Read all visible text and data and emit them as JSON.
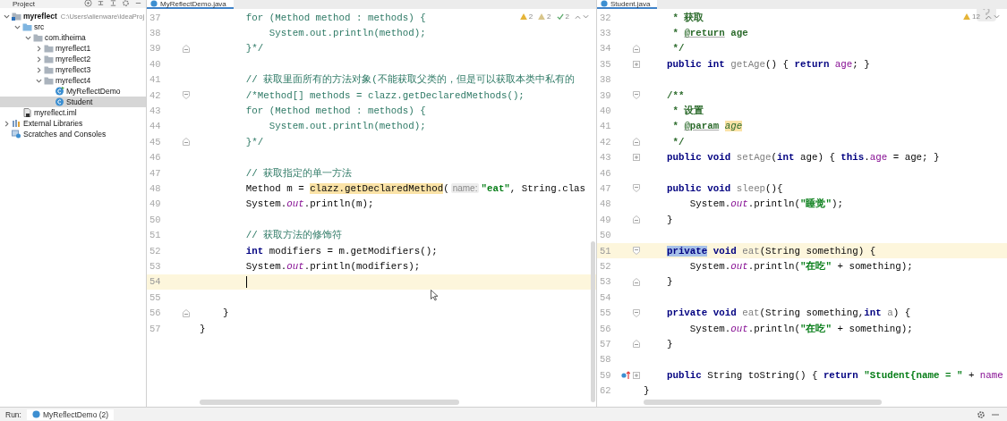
{
  "project": {
    "title": "Project",
    "tree": [
      {
        "label": "myreflect",
        "note": "C:\\Users\\alienware\\IdeaProj",
        "kind": "module",
        "expanded": true,
        "selected": false,
        "children": [
          {
            "label": "src",
            "kind": "source",
            "expanded": true,
            "selected": false,
            "children": [
              {
                "label": "com.itheima",
                "kind": "package",
                "expanded": true,
                "selected": false,
                "children": [
                  {
                    "label": "myreflect1",
                    "kind": "package",
                    "expanded": false,
                    "selected": false
                  },
                  {
                    "label": "myreflect2",
                    "kind": "package",
                    "expanded": false,
                    "selected": false
                  },
                  {
                    "label": "myreflect3",
                    "kind": "package",
                    "expanded": false,
                    "selected": false
                  },
                  {
                    "label": "myreflect4",
                    "kind": "package",
                    "expanded": true,
                    "selected": false,
                    "children": [
                      {
                        "label": "MyReflectDemo",
                        "kind": "main-class",
                        "selected": false
                      },
                      {
                        "label": "Student",
                        "kind": "class",
                        "selected": true
                      }
                    ]
                  }
                ]
              }
            ]
          },
          {
            "label": "myreflect.iml",
            "kind": "iml",
            "selected": false
          }
        ]
      },
      {
        "label": "External Libraries",
        "kind": "library",
        "expanded": false,
        "selected": false
      },
      {
        "label": "Scratches and Consoles",
        "kind": "scratches",
        "selected": false
      }
    ]
  },
  "editors": [
    {
      "tab": "MyReflectDemo.java",
      "focused": true,
      "help": false,
      "inspections": [
        {
          "kind": "warning",
          "count": "2"
        },
        {
          "kind": "weak",
          "count": "2"
        },
        {
          "kind": "typo",
          "count": "2"
        }
      ],
      "lines": [
        {
          "number": "37",
          "current": false,
          "kind": "plain",
          "tokens": [
            {
              "text": "        for (Method method : methods) {",
              "kind": "cm"
            }
          ]
        },
        {
          "number": "38",
          "current": false,
          "kind": "plain",
          "tokens": [
            {
              "text": "            System.out.println(method);",
              "kind": "cm"
            }
          ]
        },
        {
          "number": "39",
          "current": false,
          "kind": "fold-end",
          "tokens": [
            {
              "text": "        }*/",
              "kind": "cm"
            }
          ]
        },
        {
          "number": "40",
          "current": false,
          "kind": "plain"
        },
        {
          "number": "41",
          "current": false,
          "kind": "plain",
          "tokens": [
            {
              "text": "        // 获取里面所有的方法对象(不能获取父类的，但是可以获取本类中私有的",
              "kind": "cm"
            }
          ]
        },
        {
          "number": "42",
          "current": false,
          "kind": "fold-start",
          "tokens": [
            {
              "text": "        /*Method[] methods = clazz.getDeclaredMethods();",
              "kind": "cm"
            }
          ]
        },
        {
          "number": "43",
          "current": false,
          "kind": "plain",
          "tokens": [
            {
              "text": "        for (Method method : methods) {",
              "kind": "cm"
            }
          ]
        },
        {
          "number": "44",
          "current": false,
          "kind": "plain",
          "tokens": [
            {
              "text": "            System.out.println(method);",
              "kind": "cm"
            }
          ]
        },
        {
          "number": "45",
          "current": false,
          "kind": "fold-end",
          "tokens": [
            {
              "text": "        }*/",
              "kind": "cm"
            }
          ]
        },
        {
          "number": "46",
          "current": false,
          "kind": "plain"
        },
        {
          "number": "47",
          "current": false,
          "kind": "plain",
          "tokens": [
            {
              "text": "        // 获取指定的单一方法",
              "kind": "cm"
            }
          ]
        },
        {
          "number": "48",
          "current": false,
          "kind": "plain",
          "tokens": [
            {
              "text": "        Method m = ",
              "kind": "pl"
            },
            {
              "text": "clazz.getDeclaredMethod",
              "kind": "hl"
            },
            {
              "text": "(",
              "kind": "pl"
            },
            {
              "text": "name:",
              "kind": "hint"
            },
            {
              "text": "\"eat\"",
              "kind": "str"
            },
            {
              "text": ", String.clas",
              "kind": "pl"
            }
          ]
        },
        {
          "number": "49",
          "current": false,
          "kind": "plain",
          "tokens": [
            {
              "text": "        System.",
              "kind": "pl"
            },
            {
              "text": "out",
              "kind": "it"
            },
            {
              "text": ".println(m);",
              "kind": "pl"
            }
          ]
        },
        {
          "number": "50",
          "current": false,
          "kind": "plain"
        },
        {
          "number": "51",
          "current": false,
          "kind": "plain",
          "tokens": [
            {
              "text": "        // 获取方法的修饰符",
              "kind": "cm"
            }
          ]
        },
        {
          "number": "52",
          "current": false,
          "kind": "plain",
          "tokens": [
            {
              "text": "        int",
              "kind": "kw"
            },
            {
              "text": " modifiers = m.getModifiers();",
              "kind": "pl"
            }
          ]
        },
        {
          "number": "53",
          "current": false,
          "kind": "plain",
          "tokens": [
            {
              "text": "        System.",
              "kind": "pl"
            },
            {
              "text": "out",
              "kind": "it"
            },
            {
              "text": ".println(modifiers);",
              "kind": "pl"
            }
          ]
        },
        {
          "number": "54",
          "current": true,
          "kind": "plain"
        },
        {
          "number": "55",
          "current": false,
          "kind": "plain"
        },
        {
          "number": "56",
          "current": false,
          "kind": "fold-end",
          "tokens": [
            {
              "text": "    }",
              "kind": "pl"
            }
          ]
        },
        {
          "number": "57",
          "current": false,
          "kind": "plain",
          "tokens": [
            {
              "text": "}",
              "kind": "pl"
            }
          ]
        }
      ]
    },
    {
      "tab": "Student.java",
      "focused": false,
      "help": true,
      "inspections": [
        {
          "kind": "warning",
          "count": "12"
        }
      ],
      "lines": [
        {
          "number": "32",
          "current": false,
          "kind": "plain",
          "tokens": [
            {
              "text": "     * 获取",
              "kind": "doc"
            }
          ]
        },
        {
          "number": "33",
          "current": false,
          "kind": "plain",
          "tokens": [
            {
              "text": "     * ",
              "kind": "doc"
            },
            {
              "text": "@return",
              "kind": "tag"
            },
            {
              "text": " age",
              "kind": "doc"
            }
          ]
        },
        {
          "number": "34",
          "current": false,
          "kind": "fold-end",
          "tokens": [
            {
              "text": "     */",
              "kind": "doc"
            }
          ]
        },
        {
          "number": "35",
          "current": false,
          "kind": "folded",
          "tokens": [
            {
              "text": "    public int ",
              "kind": "kw"
            },
            {
              "text": "getAge",
              "kind": "fn"
            },
            {
              "text": "() { ",
              "kind": "pl"
            },
            {
              "text": "return ",
              "kind": "kw"
            },
            {
              "text": "age",
              "kind": "fld"
            },
            {
              "text": "; }",
              "kind": "pl"
            }
          ]
        },
        {
          "number": "38",
          "current": false,
          "kind": "plain"
        },
        {
          "number": "39",
          "current": false,
          "kind": "fold-start",
          "tokens": [
            {
              "text": "    /**",
              "kind": "doc"
            }
          ]
        },
        {
          "number": "40",
          "current": false,
          "kind": "plain",
          "tokens": [
            {
              "text": "     * 设置",
              "kind": "doc"
            }
          ]
        },
        {
          "number": "41",
          "current": false,
          "kind": "plain",
          "tokens": [
            {
              "text": "     * ",
              "kind": "doc"
            },
            {
              "text": "@param",
              "kind": "tag"
            },
            {
              "text": " age",
              "kind": "param"
            }
          ]
        },
        {
          "number": "42",
          "current": false,
          "kind": "fold-end",
          "tokens": [
            {
              "text": "     */",
              "kind": "doc"
            }
          ]
        },
        {
          "number": "43",
          "current": false,
          "kind": "folded",
          "tokens": [
            {
              "text": "    public void ",
              "kind": "kw"
            },
            {
              "text": "setAge",
              "kind": "fn"
            },
            {
              "text": "(",
              "kind": "pl"
            },
            {
              "text": "int",
              "kind": "kw"
            },
            {
              "text": " age) { ",
              "kind": "pl"
            },
            {
              "text": "this",
              "kind": "kw"
            },
            {
              "text": ".",
              "kind": "pl"
            },
            {
              "text": "age",
              "kind": "fld"
            },
            {
              "text": " = age; }",
              "kind": "pl"
            }
          ]
        },
        {
          "number": "46",
          "current": false,
          "kind": "plain"
        },
        {
          "number": "47",
          "current": false,
          "kind": "fold-start",
          "tokens": [
            {
              "text": "    public void ",
              "kind": "kw"
            },
            {
              "text": "sleep",
              "kind": "fn"
            },
            {
              "text": "(){",
              "kind": "pl"
            }
          ]
        },
        {
          "number": "48",
          "current": false,
          "kind": "plain",
          "tokens": [
            {
              "text": "        System.",
              "kind": "pl"
            },
            {
              "text": "out",
              "kind": "it"
            },
            {
              "text": ".println(",
              "kind": "pl"
            },
            {
              "text": "\"睡觉\"",
              "kind": "str"
            },
            {
              "text": ");",
              "kind": "pl"
            }
          ]
        },
        {
          "number": "49",
          "current": false,
          "kind": "fold-end",
          "tokens": [
            {
              "text": "    }",
              "kind": "pl"
            }
          ]
        },
        {
          "number": "50",
          "current": false,
          "kind": "plain"
        },
        {
          "number": "51",
          "current": true,
          "kind": "fold-start",
          "tokens": [
            {
              "text": "    private",
              "kind": "sel"
            },
            {
              "text": " void ",
              "kind": "kw"
            },
            {
              "text": "eat",
              "kind": "fn"
            },
            {
              "text": "(String something) {",
              "kind": "pl"
            }
          ]
        },
        {
          "number": "52",
          "current": false,
          "kind": "plain",
          "tokens": [
            {
              "text": "        System.",
              "kind": "pl"
            },
            {
              "text": "out",
              "kind": "it"
            },
            {
              "text": ".println(",
              "kind": "pl"
            },
            {
              "text": "\"在吃\"",
              "kind": "str"
            },
            {
              "text": " + something);",
              "kind": "pl"
            }
          ]
        },
        {
          "number": "53",
          "current": false,
          "kind": "fold-end",
          "tokens": [
            {
              "text": "    }",
              "kind": "pl"
            }
          ]
        },
        {
          "number": "54",
          "current": false,
          "kind": "plain"
        },
        {
          "number": "55",
          "current": false,
          "kind": "fold-start",
          "tokens": [
            {
              "text": "    private void ",
              "kind": "kw"
            },
            {
              "text": "eat",
              "kind": "fn"
            },
            {
              "text": "(String something,",
              "kind": "pl"
            },
            {
              "text": "int",
              "kind": "kw"
            },
            {
              "text": " a",
              "kind": "fn"
            },
            {
              "text": ") {",
              "kind": "pl"
            }
          ]
        },
        {
          "number": "56",
          "current": false,
          "kind": "plain",
          "tokens": [
            {
              "text": "        System.",
              "kind": "pl"
            },
            {
              "text": "out",
              "kind": "it"
            },
            {
              "text": ".println(",
              "kind": "pl"
            },
            {
              "text": "\"在吃\"",
              "kind": "str"
            },
            {
              "text": " + something);",
              "kind": "pl"
            }
          ]
        },
        {
          "number": "57",
          "current": false,
          "kind": "fold-end",
          "tokens": [
            {
              "text": "    }",
              "kind": "pl"
            }
          ]
        },
        {
          "number": "58",
          "current": false,
          "kind": "plain"
        },
        {
          "number": "59",
          "current": false,
          "kind": "folded-override",
          "tokens": [
            {
              "text": "    public ",
              "kind": "kw"
            },
            {
              "text": "String toString() { ",
              "kind": "pl"
            },
            {
              "text": "return ",
              "kind": "kw"
            },
            {
              "text": "\"Student{name = \"",
              "kind": "str"
            },
            {
              "text": " + ",
              "kind": "pl"
            },
            {
              "text": "name",
              "kind": "fld"
            }
          ]
        },
        {
          "number": "62",
          "current": false,
          "kind": "plain",
          "tokens": [
            {
              "text": "}",
              "kind": "pl"
            }
          ]
        }
      ]
    }
  ],
  "run_bar": {
    "label": "Run:",
    "tab": "MyReflectDemo (2)"
  }
}
